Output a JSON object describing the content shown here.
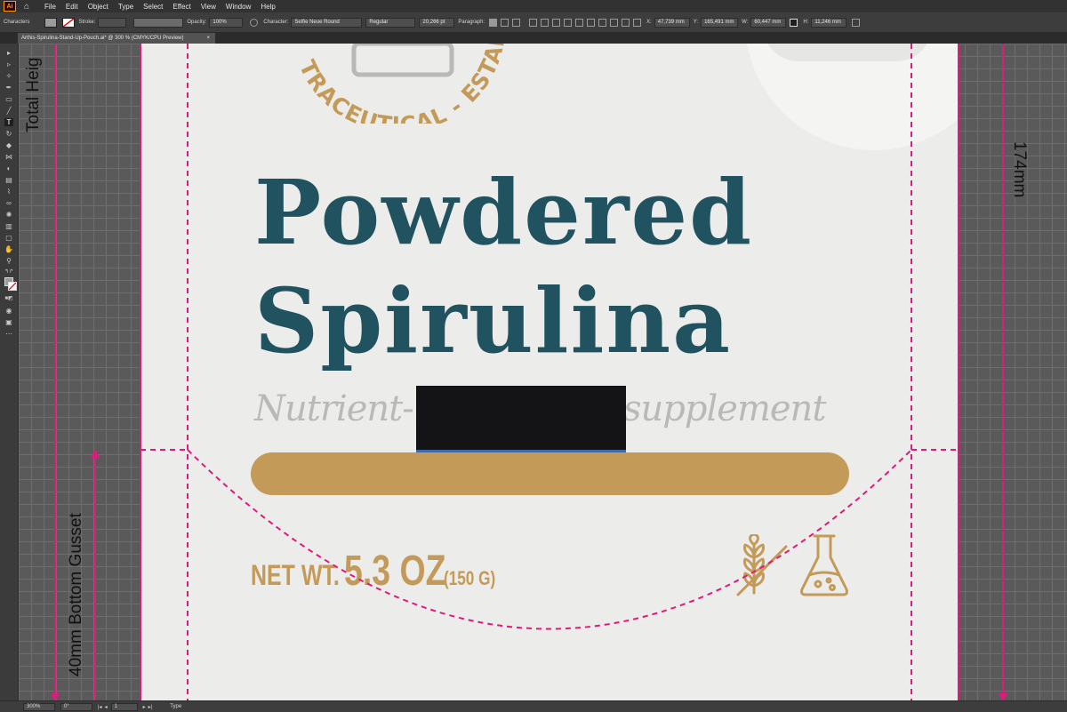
{
  "menu": {
    "app_logo": "Ai",
    "items": [
      "File",
      "Edit",
      "Object",
      "Type",
      "Select",
      "Effect",
      "View",
      "Window",
      "Help"
    ]
  },
  "control_bar": {
    "panel_label": "Characters",
    "stroke_label": "Stroke:",
    "opacity_label": "Opacity:",
    "opacity_value": "100%",
    "character_label": "Character:",
    "font_family": "Selfie Neue Round",
    "font_style": "Regular",
    "font_size": "20,266 pt",
    "paragraph_label": "Paragraph:",
    "x_label": "X:",
    "x_value": "47,739 mm",
    "y_label": "Y:",
    "y_value": "165,491 mm",
    "w_label": "W:",
    "w_value": "60,447 mm",
    "h_label": "H:",
    "h_value": "11,246 mm"
  },
  "document": {
    "tab_title": "Arthis-Spirulina-Stand-Up-Pouch.ai* @ 300 % (CMYK/CPU Preview)",
    "tab_close": "×"
  },
  "artwork": {
    "badge_arc_text": "TRACEUTICAL - ESTABLISHED",
    "title_line1": "Powdered",
    "title_line2": "Spirulina",
    "subtitle": "Nutrient-rich dietary supplement",
    "net_wt_label": "NET WT.",
    "net_wt_value": "5.3 OZ",
    "net_wt_metric": "(150 G)",
    "colors": {
      "title": "#215260",
      "gold": "#c49a59",
      "artboard": "#ececea",
      "guide": "#e0197d",
      "selection": "#3f68a8"
    }
  },
  "annotations": {
    "total_height": "Total Heig",
    "height_value": "174mm",
    "bottom_gusset": "40mm Bottom Gusset"
  },
  "status_bar": {
    "zoom": "300%",
    "rotation": "0°",
    "artboard_nav": "1",
    "tool_name": "Type"
  }
}
